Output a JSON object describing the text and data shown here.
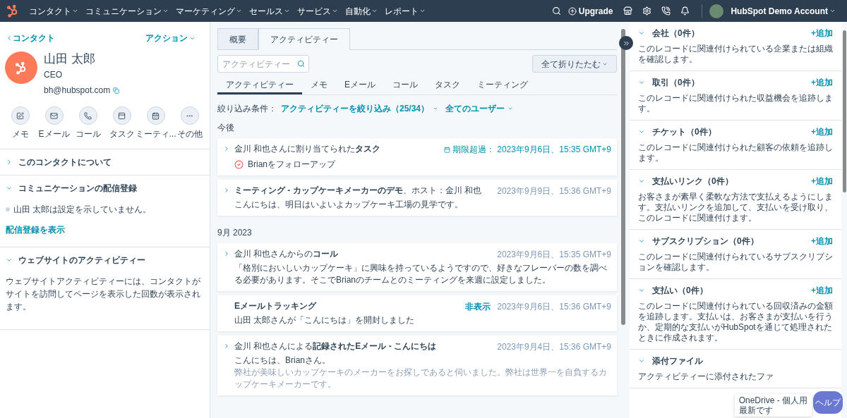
{
  "nav": {
    "items": [
      "コンタクト",
      "コミュニケーション",
      "マーケティング",
      "セールス",
      "サービス",
      "自動化",
      "レポート"
    ],
    "upgrade": "Upgrade",
    "account": "HubSpot Demo Account"
  },
  "contact": {
    "back": "コンタクト",
    "actions": "アクション",
    "name": "山田 太郎",
    "title": "CEO",
    "email": "bh@hubspot.com",
    "quick_actions": [
      {
        "kind": "note",
        "label": "メモ"
      },
      {
        "kind": "email",
        "label": "Eメール"
      },
      {
        "kind": "call",
        "label": "コール"
      },
      {
        "kind": "task",
        "label": "タスク"
      },
      {
        "kind": "meeting",
        "label": "ミーティ..."
      },
      {
        "kind": "more",
        "label": "その他"
      }
    ],
    "sections": [
      {
        "title": "このコンタクトについて",
        "expanded": false
      },
      {
        "title": "コミュニケーションの配信登録",
        "expanded": true,
        "status": "山田 太郎は設定を示していません。",
        "link": "配信登録を表示"
      },
      {
        "title": "ウェブサイトのアクティビティー",
        "expanded": true,
        "text": "ウェブサイトアクティビティーには、コンタクトがサイトを訪問してページを表示した回数が表示されます。"
      }
    ]
  },
  "timeline": {
    "tabs": [
      {
        "label": "概要",
        "selected": false
      },
      {
        "label": "アクティビティー",
        "selected": true
      }
    ],
    "search": {
      "placeholder": "アクティビティー"
    },
    "collapse_all": "全て折りたたむ",
    "subtabs": [
      {
        "label": "アクティビティー",
        "selected": true
      },
      {
        "label": "メモ",
        "selected": false
      },
      {
        "label": "Eメール",
        "selected": false
      },
      {
        "label": "コール",
        "selected": false
      },
      {
        "label": "タスク",
        "selected": false
      },
      {
        "label": "ミーティング",
        "selected": false
      }
    ],
    "filter_label": "絞り込み条件：",
    "filter": "アクティビティーを絞り込み（25/34）",
    "users": "全てのユーザー",
    "groups": [
      {
        "heading": "今後",
        "cards": [
          {
            "kind": "expandable",
            "title": "金川 和也さんに割り当てられた**タスク**",
            "due_label": "期限超過：",
            "date": "2023年9月6日、15:35 GMT+9",
            "task": "Brianをフォローアップ"
          },
          {
            "kind": "expandable",
            "title": "**ミーティング - カップケーキメーカーのデモ**、ホスト：金川 和也",
            "date": "2023年9月9日、15:36 GMT+9",
            "body": "こんにちは、明日はいよいよカップケーキ工場の見学です。"
          }
        ]
      },
      {
        "heading": "9月 2023",
        "cards": [
          {
            "kind": "expandable",
            "title": "金川 和也さんからの**コール**",
            "date": "2023年9月6日、15:35 GMT+9",
            "body": "「格別においしいカップケーキ」に興味を持っているようですので、好きなフレーバーの数を調べる必要があります。そこでBrianのチームとのミーティングを来週に設定しました。"
          },
          {
            "kind": "tracking",
            "title": "**Eメールトラッキング**",
            "hide": "非表示",
            "date": "2023年9月6日、15:36 GMT+9",
            "body": "山田 太郎さんが「こんにちは」を開封しました"
          },
          {
            "kind": "expandable",
            "title": "金川 和也さんによる**記録されたEメール - こんにちは**",
            "date": "2023年9月4日、15:36 GMT+9",
            "body": "こんにちは、Brianさん。",
            "preview": "弊社が美味しいカップケーキのメーカーをお探しであると伺いました。弊社は世界一を自負するカップケーキメーカーです。"
          }
        ]
      }
    ]
  },
  "associations": [
    {
      "title": "会社（0件）",
      "expanded": true,
      "add": "+追加",
      "text": "このレコードに関連付けられている企業または組織を確認します。"
    },
    {
      "title": "取引（0件）",
      "expanded": true,
      "add": "+追加",
      "text": "このレコードに関連付けられた収益機会を追跡します。"
    },
    {
      "title": "チケット（0件）",
      "expanded": true,
      "add": "+追加",
      "text": "このレコードに関連付けられた顧客の依頼を追跡します。"
    },
    {
      "title": "支払いリンク（0件）",
      "expanded": true,
      "add": "+追加",
      "text": "お客さまが素早く柔軟な方法で支払えるようにします。支払いリンクを追加して、支払いを受け取り、このレコードに関連付けます。"
    },
    {
      "title": "サブスクリプション（0件）",
      "expanded": true,
      "add": "+追加",
      "text": "このレコードに関連付けられているサブスクリプションを確認します。"
    },
    {
      "title": "支払い（0件）",
      "expanded": true,
      "add": "+追加",
      "text": "このレコードに関連付けられている回収済みの金額を追跡します。支払いは、お客さまが支払いを行うか、定期的な支払いがHubSpotを通じて処理されたときに作成されます。"
    },
    {
      "title": "添付ファイル",
      "expanded": true,
      "text": "アクティビティーに添付されたファ"
    }
  ],
  "toast": {
    "title": "OneDrive - 個人用",
    "text": "最新です"
  },
  "help": "ヘルプ"
}
